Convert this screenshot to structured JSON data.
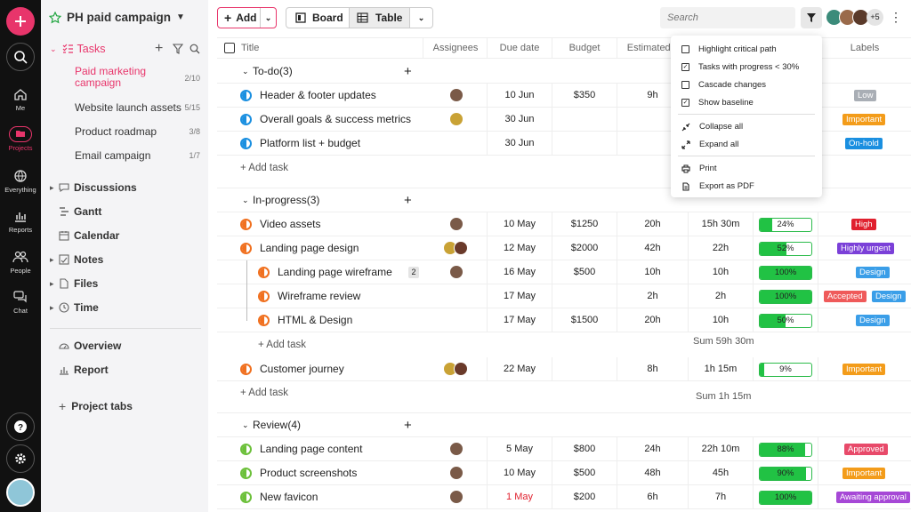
{
  "project": {
    "title": "PH paid campaign"
  },
  "rail": {
    "me": "Me",
    "projects": "Projects",
    "everything": "Everything",
    "reports": "Reports",
    "people": "People",
    "chat": "Chat"
  },
  "sidebar": {
    "tasks": "Tasks",
    "subs": [
      {
        "label": "Paid marketing campaign",
        "count": "2/10"
      },
      {
        "label": "Website launch assets",
        "count": "5/15"
      },
      {
        "label": "Product roadmap",
        "count": "3/8"
      },
      {
        "label": "Email campaign",
        "count": "1/7"
      }
    ],
    "items": [
      "Discussions",
      "Gantt",
      "Calendar",
      "Notes",
      "Files",
      "Time"
    ],
    "overview": "Overview",
    "report": "Report",
    "project_tabs": "Project tabs"
  },
  "toolbar": {
    "add": "Add",
    "board": "Board",
    "table": "Table",
    "search_placeholder": "Search",
    "more_count": "+5"
  },
  "columns": [
    "Title",
    "Assignees",
    "Due date",
    "Budget",
    "Estimated ti",
    "",
    "",
    "Labels"
  ],
  "groups": [
    {
      "name": "To-do",
      "count": "(3)",
      "add_task": "+ Add task",
      "sum": ""
    },
    {
      "name": "In-progress",
      "count": "(3)",
      "add_task": "+ Add task",
      "sum": "Sum 1h 15m"
    },
    {
      "name": "Review",
      "count": "(4)",
      "add_task": "",
      "sum": ""
    }
  ],
  "subtask_add": "+ Add task",
  "subtask_sum": "Sum 59h 30m",
  "rows": {
    "r1": {
      "name": "Header & footer updates",
      "due": "10 Jun",
      "budget": "$350",
      "est": "9h",
      "label": "Low"
    },
    "r2": {
      "name": "Overall goals & success metrics",
      "due": "30 Jun",
      "label": "Important"
    },
    "r3": {
      "name": "Platform list + budget",
      "due": "30 Jun",
      "label": "On-hold"
    },
    "r4": {
      "name": "Video assets",
      "due": "10 May",
      "budget": "$1250",
      "est": "20h",
      "spent": "15h 30m",
      "progress": "24%",
      "label": "High"
    },
    "r5": {
      "name": "Landing page design",
      "due": "12 May",
      "budget": "$2000",
      "est": "42h",
      "spent": "22h",
      "progress": "52%",
      "label": "Highly urgent"
    },
    "r6": {
      "name": "Landing page wireframe",
      "badge": "2",
      "due": "16 May",
      "budget": "$500",
      "est": "10h",
      "spent": "10h",
      "progress": "100%",
      "label": "Design"
    },
    "r7": {
      "name": "Wireframe review",
      "due": "17 May",
      "est": "2h",
      "spent": "2h",
      "progress": "100%",
      "label": "Accepted",
      "label2": "Design"
    },
    "r8": {
      "name": "HTML & Design",
      "due": "17 May",
      "budget": "$1500",
      "est": "20h",
      "spent": "10h",
      "progress": "50%",
      "label": "Design"
    },
    "r9": {
      "name": "Customer journey",
      "due": "22 May",
      "est": "8h",
      "spent": "1h 15m",
      "progress": "9%",
      "label": "Important"
    },
    "r10": {
      "name": "Landing page content",
      "due": "5 May",
      "budget": "$800",
      "est": "24h",
      "spent": "22h 10m",
      "progress": "88%",
      "label": "Approved"
    },
    "r11": {
      "name": "Product screenshots",
      "due": "10 May",
      "budget": "$500",
      "est": "48h",
      "spent": "45h",
      "progress": "90%",
      "label": "Important"
    },
    "r12": {
      "name": "New favicon",
      "due": "1 May",
      "budget": "$200",
      "est": "6h",
      "spent": "7h",
      "progress": "100%",
      "label": "Awaiting approval"
    }
  },
  "menu": {
    "highlight": "Highlight critical path",
    "tasks_progress": "Tasks with progress < 30%",
    "cascade": "Cascade changes",
    "baseline": "Show baseline",
    "collapse": "Collapse all",
    "expand": "Expand all",
    "print": "Print",
    "export": "Export as PDF"
  },
  "colors": {
    "accent": "#e8356b",
    "green": "#21c244",
    "orange": "#f0701f",
    "blue": "#1a8fe0"
  }
}
